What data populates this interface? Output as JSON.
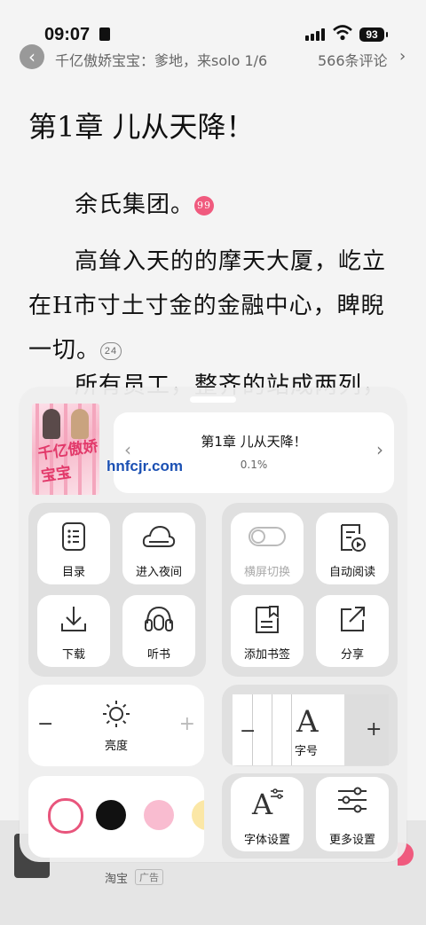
{
  "status_bar": {
    "time": "09:07",
    "battery": "93"
  },
  "top_bar": {
    "book_title": "千亿傲娇宝宝：爹地，来solo 1/6",
    "comments": "566条评论"
  },
  "content": {
    "chapter_title": "第1章 儿从天降！",
    "paragraphs": [
      {
        "text": "余氏集团。",
        "badge": "99"
      },
      {
        "text": "高耸入天的的摩天大厦，屹立在H市寸土寸金的金融中心，睥睨一切。",
        "badge": "24"
      },
      {
        "text": "所有员工，整齐的站成两列，"
      }
    ]
  },
  "panel": {
    "chapter_card": {
      "title": "第1章 儿从天降！",
      "progress": "0.1%"
    },
    "watermark": "hnfcjr.com",
    "menu_left": [
      "目录",
      "进入夜间",
      "下载",
      "听书"
    ],
    "menu_right": [
      "横屏切换",
      "自动阅读",
      "添加书签",
      "分享"
    ],
    "brightness": {
      "label": "亮度"
    },
    "font_size": {
      "label": "字号"
    },
    "settings": [
      "字体设置",
      "更多设置"
    ],
    "bg_colors": [
      "#ffffff",
      "#111111",
      "#f9bcd0",
      "#fbe7a6"
    ]
  },
  "bottom_strip": {
    "name": "淘宝",
    "tag": "广告"
  }
}
